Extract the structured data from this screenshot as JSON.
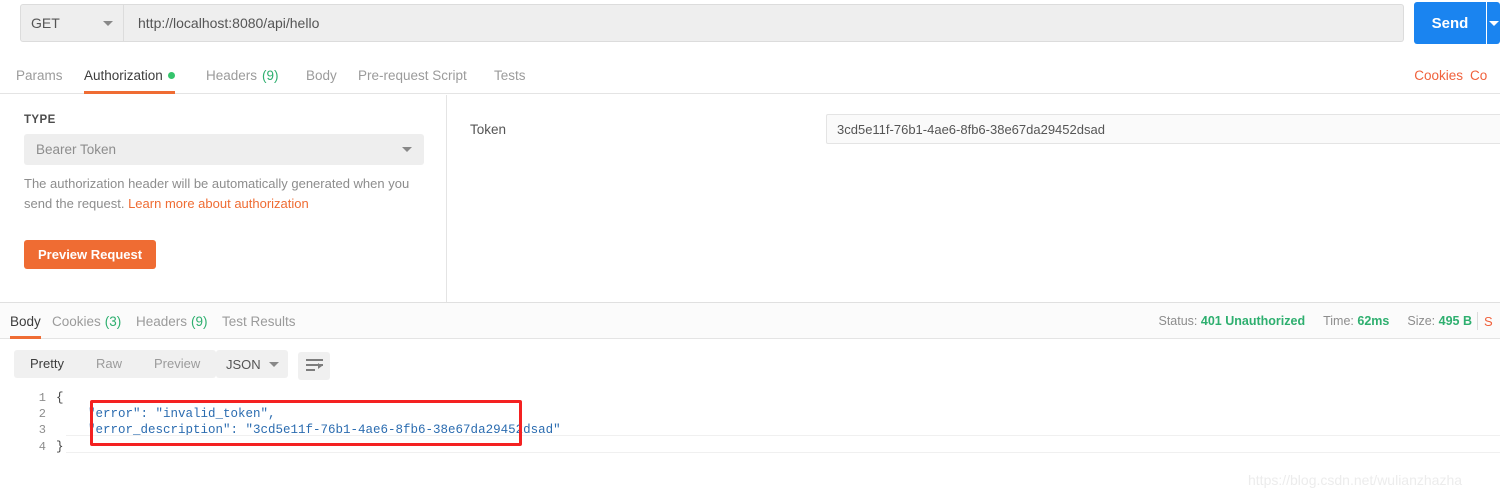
{
  "url_bar": {
    "method": "GET",
    "url": "http://localhost:8080/api/hello",
    "send_label": "Send"
  },
  "request_tabs": {
    "items": [
      {
        "label": "Params",
        "count": "",
        "active": false,
        "dot": false
      },
      {
        "label": "Authorization",
        "count": "",
        "active": true,
        "dot": true
      },
      {
        "label": "Headers",
        "count": "(9)",
        "active": false,
        "dot": false
      },
      {
        "label": "Body",
        "count": "",
        "active": false,
        "dot": false
      },
      {
        "label": "Pre-request Script",
        "count": "",
        "active": false,
        "dot": false
      },
      {
        "label": "Tests",
        "count": "",
        "active": false,
        "dot": false
      }
    ],
    "cookies_link": "Cookies",
    "code_link": "Co"
  },
  "auth": {
    "type_label": "TYPE",
    "type_value": "Bearer Token",
    "help_text": "The authorization header will be automatically generated when you send the request. ",
    "help_link": "Learn more about authorization",
    "preview_button": "Preview Request",
    "token_label": "Token",
    "token_value": "3cd5e11f-76b1-4ae6-8fb6-38e67da29452dsad"
  },
  "response_tabs": {
    "items": [
      {
        "label": "Body",
        "count": "",
        "active": true
      },
      {
        "label": "Cookies",
        "count": "(3)",
        "active": false
      },
      {
        "label": "Headers",
        "count": "(9)",
        "active": false
      },
      {
        "label": "Test Results",
        "count": "",
        "active": false
      }
    ],
    "save_link": "S"
  },
  "response_meta": {
    "status_label": "Status:",
    "status_value": "401 Unauthorized",
    "time_label": "Time:",
    "time_value": "62ms",
    "size_label": "Size:",
    "size_value": "495 B"
  },
  "body_toolbar": {
    "views": [
      {
        "label": "Pretty",
        "active": true
      },
      {
        "label": "Raw",
        "active": false
      },
      {
        "label": "Preview",
        "active": false
      }
    ],
    "format": "JSON"
  },
  "response_body": {
    "lines": [
      {
        "num": "1",
        "text": "{",
        "indent": 0
      },
      {
        "num": "2",
        "text": "\"error\": \"invalid_token\",",
        "indent": 1
      },
      {
        "num": "3",
        "text": "\"error_description\": \"3cd5e11f-76b1-4ae6-8fb6-38e67da29452dsad\"",
        "indent": 1
      },
      {
        "num": "4",
        "text": "}",
        "indent": 0
      }
    ]
  },
  "watermark": "https://blog.csdn.net/wulianzhazha",
  "colors": {
    "accent_orange": "#ef6c33",
    "send_blue": "#1a84f0",
    "green": "#2eaf6f",
    "annotation_red": "#f42121"
  }
}
